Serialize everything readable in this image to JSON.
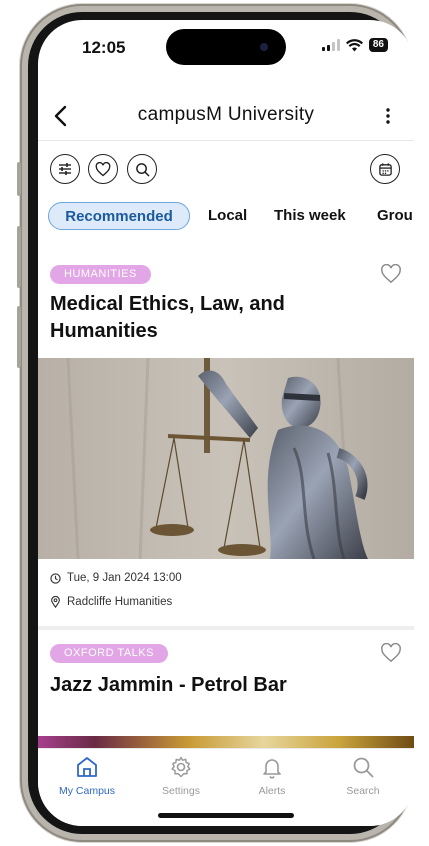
{
  "status": {
    "time": "12:05",
    "battery": "86"
  },
  "header": {
    "title": "campusM University"
  },
  "tabs": [
    "Recommended",
    "Local",
    "This week",
    "Grou"
  ],
  "cards": [
    {
      "badge": "HUMANITIES",
      "title": "Medical Ethics, Law, and Humanities",
      "datetime": "Tue, 9 Jan 2024 13:00",
      "location": "Radcliffe Humanities"
    },
    {
      "badge": "OXFORD TALKS",
      "title": "Jazz Jammin - Petrol Bar"
    }
  ],
  "nav": [
    {
      "label": "My Campus",
      "icon": "home-icon",
      "active": true
    },
    {
      "label": "Settings",
      "icon": "gear-icon",
      "active": false
    },
    {
      "label": "Alerts",
      "icon": "bell-icon",
      "active": false
    },
    {
      "label": "Search",
      "icon": "search-icon",
      "active": false
    }
  ],
  "colors": {
    "accent": "#3167c4",
    "badge": "#e2a5e6",
    "tab_active_bg": "#dceafa",
    "tab_active_border": "#6ea5de"
  }
}
